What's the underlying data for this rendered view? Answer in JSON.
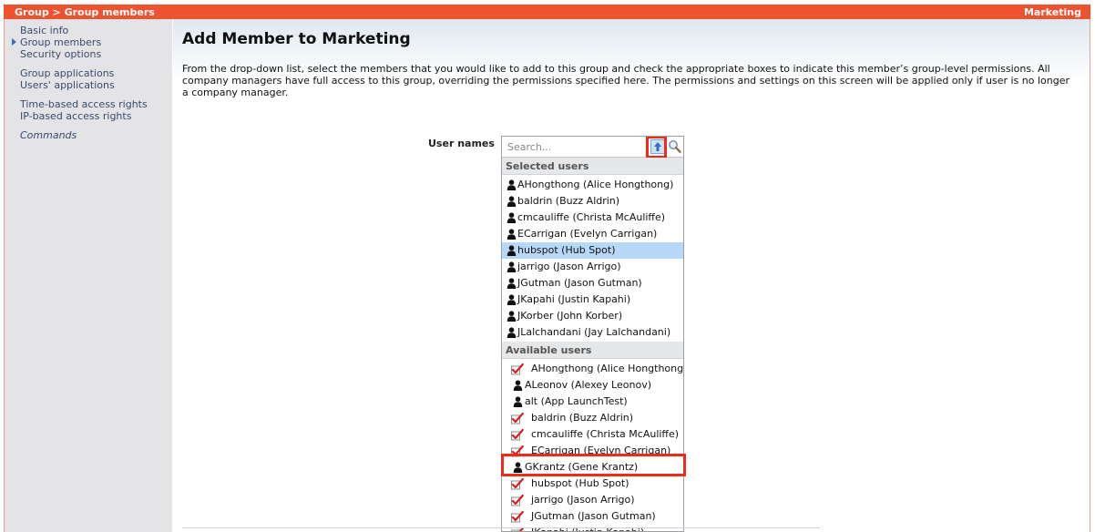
{
  "topbar": {
    "breadcrumb": "Group > Group members",
    "group_name": "Marketing"
  },
  "sidebar": {
    "items": [
      {
        "label": "Basic info"
      },
      {
        "label": "Group members",
        "active": true
      },
      {
        "label": "Security options"
      },
      {
        "label": "Group applications"
      },
      {
        "label": "Users' applications"
      },
      {
        "label": "Time-based access rights"
      },
      {
        "label": "IP-based access rights"
      },
      {
        "label": "Commands"
      }
    ]
  },
  "main": {
    "title": "Add Member to Marketing",
    "description": "From the drop-down list, select the members that you would like to add to this group and check the appropriate boxes to indicate this member’s group-level permissions. All company managers have full access to this group, overriding the permissions specified here. The permissions and settings on this screen will be applied only if user is no longer a company manager.",
    "user_names_label": "User names"
  },
  "picker": {
    "search_placeholder": "Search...",
    "selected_header": "Selected users",
    "available_header": "Available users",
    "selected_users": [
      {
        "label": "AHongthong (Alice Hongthong)"
      },
      {
        "label": "baldrin (Buzz Aldrin)"
      },
      {
        "label": "cmcauliffe (Christa McAuliffe)"
      },
      {
        "label": "ECarrigan (Evelyn Carrigan)"
      },
      {
        "label": "hubspot (Hub Spot)",
        "highlighted": true
      },
      {
        "label": "jarrigo (Jason Arrigo)"
      },
      {
        "label": "JGutman (Jason Gutman)"
      },
      {
        "label": "JKapahi (Justin Kapahi)"
      },
      {
        "label": "JKorber (John Korber)"
      },
      {
        "label": "JLalchandani (Jay Lalchandani)"
      }
    ],
    "available_users": [
      {
        "label": "AHongthong (Alice Hongthong)",
        "icon": "checked-icon"
      },
      {
        "label": "ALeonov (Alexey Leonov)",
        "icon": "user-icon"
      },
      {
        "label": "alt (App LaunchTest)",
        "icon": "user-icon"
      },
      {
        "label": "baldrin (Buzz Aldrin)",
        "icon": "checked-icon"
      },
      {
        "label": "cmcauliffe (Christa McAuliffe)",
        "icon": "checked-icon"
      },
      {
        "label": "ECarrigan (Evelyn Carrigan)",
        "icon": "checked-icon"
      },
      {
        "label": "GKrantz (Gene Krantz)",
        "icon": "user-icon"
      },
      {
        "label": "hubspot (Hub Spot)",
        "icon": "checked-icon"
      },
      {
        "label": "jarrigo (Jason Arrigo)",
        "icon": "checked-icon"
      },
      {
        "label": "JGutman (Jason Gutman)",
        "icon": "checked-icon"
      },
      {
        "label": "JKapahi (Justin Kapahi)",
        "icon": "checked-icon"
      }
    ]
  },
  "colors": {
    "topbar": "#f0512e",
    "highlight": "#ee2a1b",
    "selected_row": "#b7d8f7",
    "sidebar_link": "#3a4a6e"
  }
}
